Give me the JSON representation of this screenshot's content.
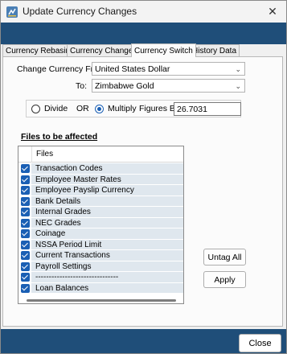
{
  "window": {
    "title": "Update Currency Changes",
    "close_glyph": "✕"
  },
  "tabs": [
    {
      "label": "Currency Rebasing"
    },
    {
      "label": "Currency Changes"
    },
    {
      "label": "Currency Switch"
    },
    {
      "label": "History Data"
    }
  ],
  "form": {
    "from_label": "Change Currency From:",
    "from_value": "United States Dollar",
    "to_label": "To:",
    "to_value": "Zimbabwe Gold",
    "divide_label": "Divide",
    "or_label": "OR",
    "multiply_label": "Multiply",
    "figures_label": "Figures By:",
    "figures_value": "26.7031",
    "selected_operation": "Multiply"
  },
  "files": {
    "section_title": "Files to be affected",
    "column_header": "Files",
    "rows": [
      {
        "label": "Transaction Codes",
        "checked": true
      },
      {
        "label": "Employee Master Rates",
        "checked": true
      },
      {
        "label": "Employee Payslip Currency",
        "checked": true
      },
      {
        "label": "Bank Details",
        "checked": true
      },
      {
        "label": "Internal Grades",
        "checked": true
      },
      {
        "label": "NEC Grades",
        "checked": true
      },
      {
        "label": "Coinage",
        "checked": true
      },
      {
        "label": "NSSA Period Limit",
        "checked": true
      },
      {
        "label": "Current Transactions",
        "checked": true
      },
      {
        "label": "Payroll Settings",
        "checked": true
      },
      {
        "label": "-------------------------------",
        "checked": true
      },
      {
        "label": "Loan Balances",
        "checked": true
      }
    ]
  },
  "buttons": {
    "untag_all": "Untag All",
    "apply": "Apply",
    "close": "Close"
  },
  "colors": {
    "accent": "#1f4e79",
    "checkbox": "#1a5fb4",
    "row_bg": "#dfe7ee"
  },
  "icons": {
    "app": "currency-app-icon",
    "dropdown": "chevron-down-icon",
    "check": "checkmark-icon"
  }
}
